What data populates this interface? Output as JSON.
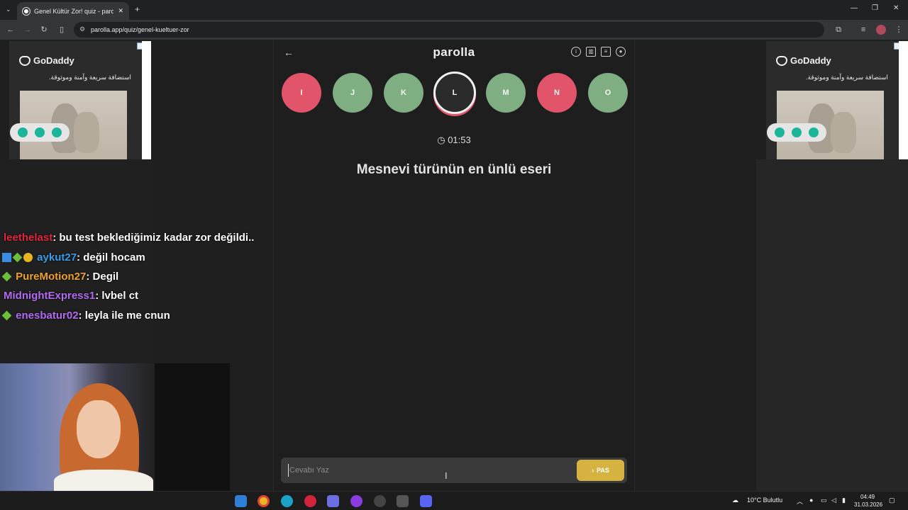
{
  "browser": {
    "tab_title": "Genel Kültür Zor! quiz - parolla",
    "tab_close": "✕",
    "new_tab": "+",
    "url": "parolla.app/quiz/genel-kueltuer-zor"
  },
  "ads": {
    "brand": "GoDaddy",
    "tagline": "استضافة سريعة وآمنة وموثوقة."
  },
  "quiz": {
    "app_name": "parolla",
    "letters": [
      {
        "letter": "I",
        "status": "wrong"
      },
      {
        "letter": "J",
        "status": "correct"
      },
      {
        "letter": "K",
        "status": "correct"
      },
      {
        "letter": "L",
        "status": "current"
      },
      {
        "letter": "M",
        "status": "correct"
      },
      {
        "letter": "N",
        "status": "wrong"
      },
      {
        "letter": "O",
        "status": "correct"
      }
    ],
    "timer": "01:53",
    "question": "Mesnevi türünün en ünlü eseri",
    "answer_placeholder": "Cevabı Yaz",
    "answer_value": "",
    "pass_label": "PAS",
    "colors": {
      "wrong": "#e2546a",
      "correct": "#7fae83",
      "pass": "#d6b340"
    }
  },
  "chat": [
    {
      "user": "leethelast",
      "user_color": "#e0253f",
      "message": ": bu test beklediğimiz kadar zor değildi.."
    },
    {
      "user": "aykut27",
      "user_color": "#3a9be6",
      "message": ": değil hocam"
    },
    {
      "user": "PureMotion27",
      "user_color": "#f0a225",
      "message": ": Degil"
    },
    {
      "user": "MidnightExpress1",
      "user_color": "#b16cf0",
      "message": ": lvbel ct"
    },
    {
      "user": "enesbatur02",
      "user_color": "#b16cf0",
      "message": ": leyla ile me cnun"
    }
  ],
  "taskbar": {
    "weather": "10°C Bulutlu",
    "time": "04:49",
    "date": "31.03.2026"
  }
}
